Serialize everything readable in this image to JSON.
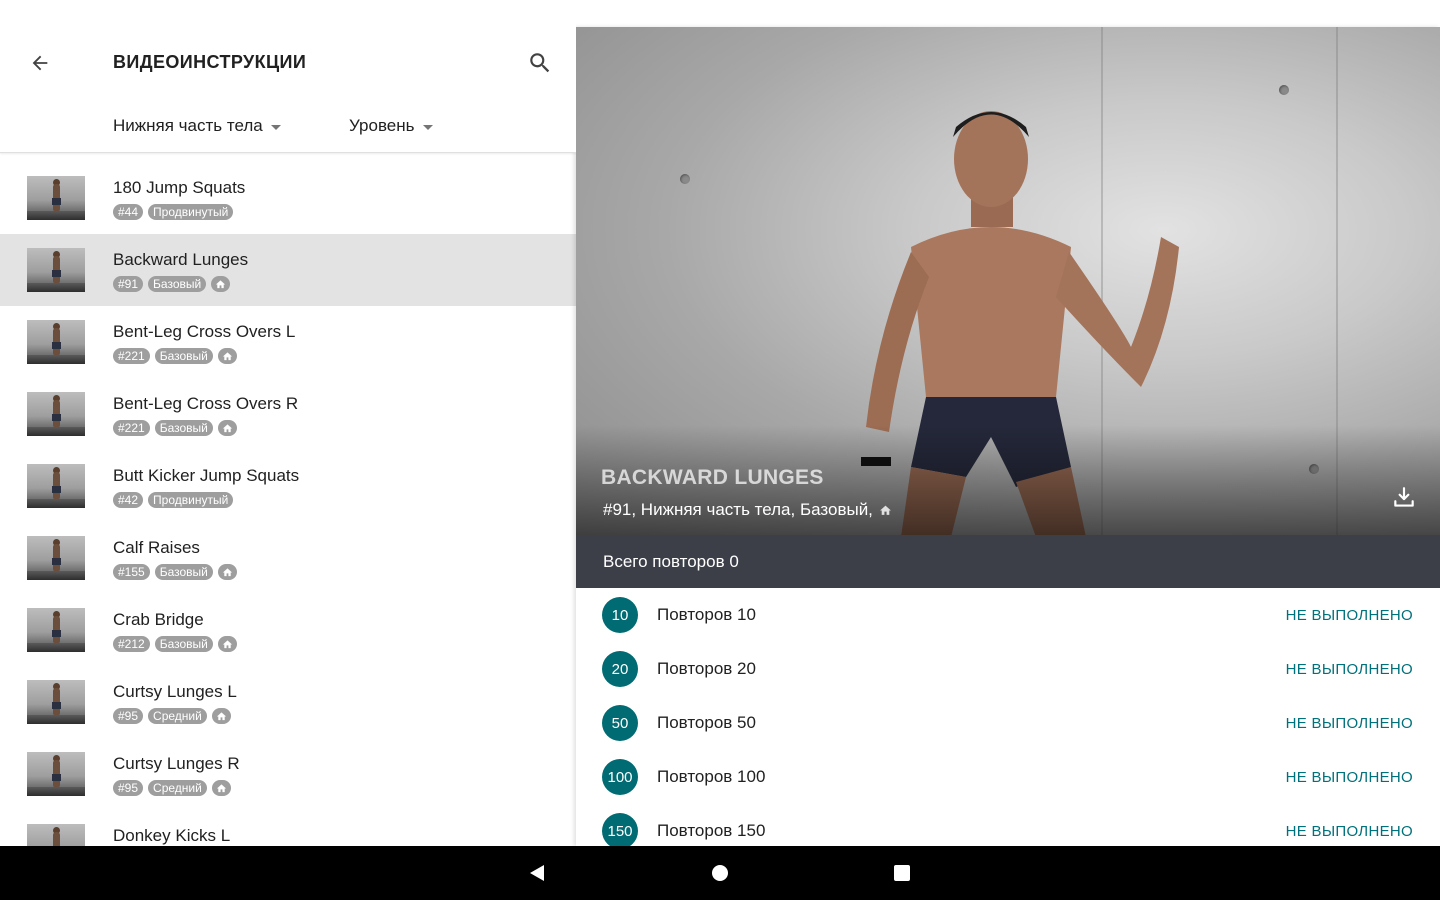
{
  "header": {
    "title": "ВИДЕОИНСТРУКЦИИ",
    "back_icon": "arrow-left-icon",
    "search_icon": "search-icon"
  },
  "filters": {
    "body_part": "Нижняя часть тела",
    "level": "Уровень"
  },
  "exercises": [
    {
      "name": "180 Jump Squats",
      "number": "#44",
      "level": "Продвинутый",
      "home": false,
      "selected": false
    },
    {
      "name": "Backward Lunges",
      "number": "#91",
      "level": "Базовый",
      "home": true,
      "selected": true
    },
    {
      "name": "Bent-Leg Cross Overs L",
      "number": "#221",
      "level": "Базовый",
      "home": true,
      "selected": false
    },
    {
      "name": "Bent-Leg Cross Overs R",
      "number": "#221",
      "level": "Базовый",
      "home": true,
      "selected": false
    },
    {
      "name": "Butt Kicker Jump Squats",
      "number": "#42",
      "level": "Продвинутый",
      "home": false,
      "selected": false
    },
    {
      "name": "Calf Raises",
      "number": "#155",
      "level": "Базовый",
      "home": true,
      "selected": false
    },
    {
      "name": "Crab Bridge",
      "number": "#212",
      "level": "Базовый",
      "home": true,
      "selected": false
    },
    {
      "name": "Curtsy Lunges L",
      "number": "#95",
      "level": "Средний",
      "home": true,
      "selected": false
    },
    {
      "name": "Curtsy Lunges R",
      "number": "#95",
      "level": "Средний",
      "home": true,
      "selected": false
    },
    {
      "name": "Donkey Kicks L",
      "number": "",
      "level": "",
      "home": false,
      "selected": false
    }
  ],
  "detail": {
    "title": "BACKWARD LUNGES",
    "subtitle": "#91, Нижняя часть тела, Базовый,",
    "home_icon": "home-icon",
    "download_icon": "download-icon",
    "total_label": "Всего повторов 0",
    "reps": [
      {
        "count": "10",
        "label": "Повторов 10",
        "status": "НЕ ВЫПОЛНЕНО"
      },
      {
        "count": "20",
        "label": "Повторов 20",
        "status": "НЕ ВЫПОЛНЕНО"
      },
      {
        "count": "50",
        "label": "Повторов 50",
        "status": "НЕ ВЫПОЛНЕНО"
      },
      {
        "count": "100",
        "label": "Повторов 100",
        "status": "НЕ ВЫПОЛНЕНО"
      },
      {
        "count": "150",
        "label": "Повторов 150",
        "status": "НЕ ВЫПОЛНЕНО"
      }
    ]
  },
  "colors": {
    "accent": "#006b72",
    "status": "#00707a",
    "total_bar": "#3c3f48",
    "tag": "#9e9e9e",
    "selected_row": "#e3e3e3"
  },
  "navbar": {
    "back_icon": "nav-back-icon",
    "home_icon": "nav-home-icon",
    "recents_icon": "nav-recents-icon"
  }
}
